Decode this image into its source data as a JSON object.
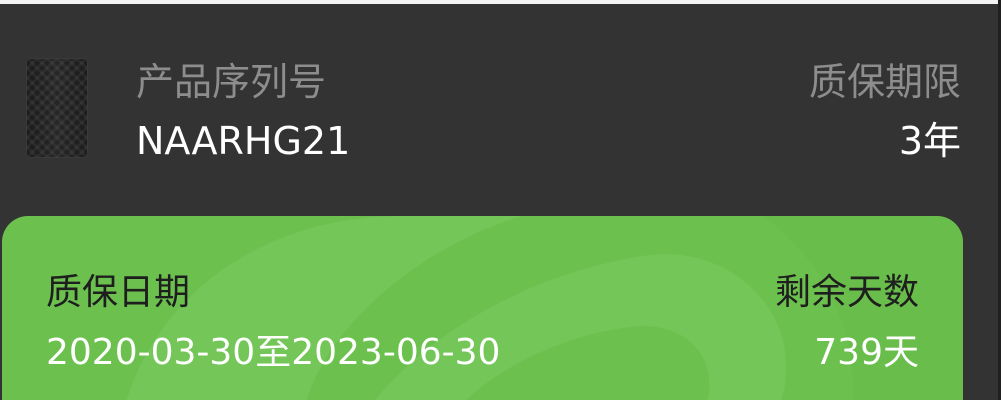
{
  "product": {
    "serial_label": "产品序列号",
    "serial_value": "NAARHG21",
    "period_label": "质保期限",
    "period_value": "3年"
  },
  "warranty": {
    "date_label": "质保日期",
    "date_value": "2020-03-30至2023-06-30",
    "remaining_label": "剩余天数",
    "remaining_value": "739天"
  },
  "colors": {
    "background": "#333333",
    "card": "#6cc14e",
    "label_gray": "#8d8d8d"
  },
  "icons": {
    "product_image": "external-hard-drive"
  }
}
